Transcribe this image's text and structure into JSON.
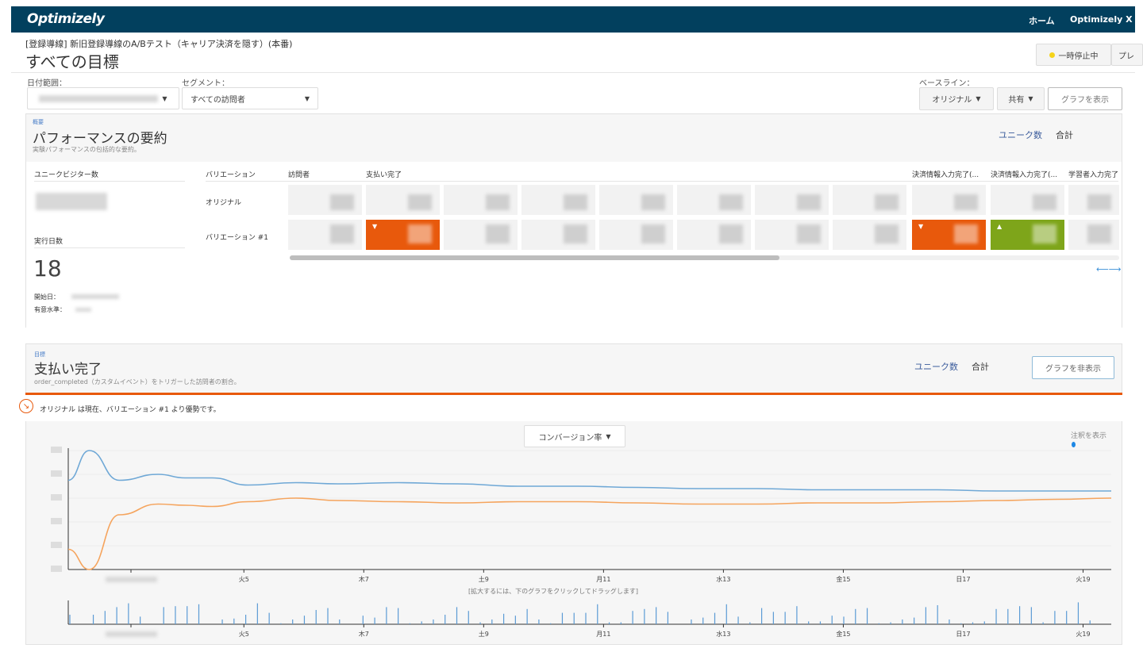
{
  "nav": {
    "logo": "Optimizely",
    "home": "ホーム",
    "product": "Optimizely X"
  },
  "header": {
    "experiment": "[登録導線] 新旧登録導線のA/Bテスト（キャリア決済を隠す）(本番)",
    "title": "すべての目標",
    "status": "一時停止中",
    "status_color": "#f5d31a",
    "cut_button": "プレ"
  },
  "filters": {
    "date_label": "日付範囲：",
    "segment_label": "セグメント：",
    "segment_value": "すべての訪問者",
    "baseline_label": "ベースライン：",
    "baseline_value": "オリジナル",
    "share": "共有",
    "show_graph": "グラフを表示"
  },
  "summary": {
    "kicker": "概要",
    "title": "パフォーマンスの要約",
    "desc": "実験パフォーマンスの包括的な要約。",
    "unique": "ユニーク数",
    "total": "合計",
    "unique_visitors_label": "ユニークビジター数",
    "days_label": "実行日数",
    "days_value": "18",
    "start_label": "開始日：",
    "significance_label": "有意水準：",
    "columns": [
      "バリエーション",
      "訪問者",
      "支払い完了",
      "決済情報入力完了(...",
      "決済情報入力完了(...",
      "学習者入力完了"
    ],
    "rows": [
      "オリジナル",
      "バリエーション #1"
    ],
    "colors": {
      "loss": "#e8590c",
      "win": "#7ea51a"
    }
  },
  "goal": {
    "kicker": "目標",
    "title": "支払い完了",
    "desc": "order_completed（カスタムイベント）をトリガーした訪問者の割合。",
    "unique": "ユニーク数",
    "total": "合計",
    "hide_graph": "グラフを非表示",
    "alert": "オリジナル は現在、バリエーション #1 より優勢です。",
    "metric": "コンバージョン率",
    "annotations": "注釈を表示",
    "zoom_hint": "[拡大するには、下のグラフをクリックしてドラッグします]"
  },
  "chart_data": {
    "type": "line",
    "xlabel": "",
    "ylabel": "コンバージョン率 (blurred, relative units)",
    "x_ticks": [
      "火5",
      "木7",
      "土9",
      "月11",
      "水13",
      "金15",
      "日17",
      "火19"
    ],
    "x": [
      2.0,
      2.35,
      2.85,
      3.5,
      3.95,
      4.4,
      5.0,
      5.8,
      6.5,
      7.5,
      8.5,
      9.5,
      10.5,
      11.5,
      12.5,
      13.5,
      14.5,
      15.5,
      16.5,
      17.5,
      18.5,
      19.4
    ],
    "series": [
      {
        "name": "オリジナル",
        "color": "#6fa8d6",
        "values": [
          75,
          100,
          75,
          80,
          77,
          77,
          71,
          73,
          72,
          73,
          72,
          70,
          70,
          69,
          68,
          68,
          67,
          67,
          67,
          66,
          66,
          66
        ]
      },
      {
        "name": "バリエーション #1",
        "color": "#f5a45d",
        "values": [
          17,
          0,
          46,
          55,
          54,
          53,
          57,
          60,
          58,
          57,
          56,
          57,
          57,
          56,
          55,
          55,
          56,
          56,
          57,
          58,
          59,
          60
        ]
      }
    ],
    "volume": {
      "type": "bar",
      "values": [
        1,
        0,
        1,
        1.4,
        1.8,
        2.2,
        0.8,
        0,
        1.8,
        1.9,
        1.9,
        2.1,
        0,
        0.5,
        0.6,
        1,
        2.2,
        1.2,
        0.1,
        0.5,
        0.9,
        1.5,
        1.7,
        0.5,
        0,
        0.9,
        0.7,
        1.8,
        1.7,
        0.1,
        0.3,
        0.5,
        1,
        1.8,
        1.4,
        0.2,
        0.5,
        1.1,
        0.9,
        1.6,
        0.5,
        0.1,
        1.2,
        1.2,
        1.2,
        2.1,
        0.2,
        0.2,
        1.4,
        1.6,
        1.8,
        1.3,
        0,
        0.5,
        0.7,
        1.2,
        2.1,
        0.8,
        0.2,
        1.7,
        1.3,
        1.3,
        1.9,
        0.3,
        0.3,
        0.9,
        0.8,
        1.6,
        1.7,
        0.1,
        0.2,
        0.5,
        0.7,
        1.8,
        2.0,
        0.5,
        0.1,
        0.2,
        0.3,
        1.6,
        1.6,
        1.9,
        1.8,
        0.2,
        1.4,
        1.4,
        2.3,
        0.4
      ]
    }
  }
}
